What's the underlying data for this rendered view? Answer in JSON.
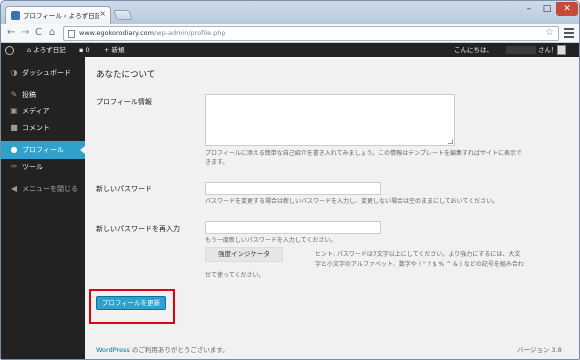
{
  "browser": {
    "tab_title": "プロフィール ‹ よろず日記 —",
    "tab_close": "×",
    "url_host": "www.egokorodiary.com",
    "url_path": "/wp-admin/profile.php",
    "star": "☆",
    "win_minimize": "–",
    "win_maximize": "□",
    "win_close": "✕",
    "nav_back": "←",
    "nav_forward": "→",
    "nav_reload": "C",
    "nav_home": "⌂"
  },
  "admin_bar": {
    "site_name": "よろず日記",
    "comments_count": "0",
    "new_label": "新規",
    "greeting": "こんにちは、",
    "san": "さん！"
  },
  "sidebar": {
    "items": [
      {
        "label": "ダッシュボード",
        "icon": "dashboard-icon",
        "glyph": "◑"
      },
      {
        "label": "投稿",
        "icon": "pin-icon",
        "glyph": "✎"
      },
      {
        "label": "メディア",
        "icon": "media-icon",
        "glyph": "▣"
      },
      {
        "label": "コメント",
        "icon": "comment-icon",
        "glyph": "■"
      },
      {
        "label": "プロフィール",
        "icon": "user-icon",
        "glyph": "●"
      },
      {
        "label": "ツール",
        "icon": "wrench-icon",
        "glyph": "✑"
      },
      {
        "label": "メニューを閉じる",
        "icon": "collapse-icon",
        "glyph": "◀"
      }
    ]
  },
  "content": {
    "section_title": "あなたについて",
    "bio_label": "プロフィール情報",
    "bio_desc_line1": "プロフィールに添える簡単な自己紹介を書き入れてみましょう。この情報はテンプレートを編集すればサイトに表示で",
    "bio_desc_line2": "きます。",
    "new_password_label": "新しいパスワード",
    "new_password_desc": "パスワードを変更する場合は新しいパスワードを入力し、変更しない場合は空のままにしておいてください。",
    "repeat_password_label": "新しいパスワードを再入力",
    "repeat_password_desc": "もう一度新しいパスワードを入力してください。",
    "strength_indicator": "強度インジケータ",
    "hint_line1": "ヒント: パスワードは7文字以上にしてください。より強力にするには、大文",
    "hint_line2": "字と小文字のアルファベット、数字や ! \" ? $ % ^ & ) などの記号を組み合わ",
    "hint_line3": "せて使ってください。",
    "update_button": "プロフィールを更新"
  },
  "footer": {
    "wordpress_link": "WordPress",
    "thanks": " のご利用ありがとうございます。",
    "version": "バージョン 3.8"
  },
  "colors": {
    "accent": "#2ea2cc",
    "highlight": "#e0000f",
    "admin_bg": "#222222"
  }
}
